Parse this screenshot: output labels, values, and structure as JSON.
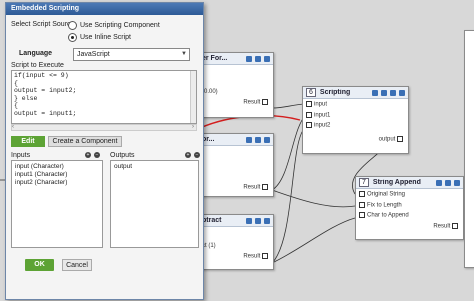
{
  "dialog": {
    "title": "Embedded Scripting",
    "source_label": "Select Script Source",
    "radio_component": "Use Scripting Component",
    "radio_inline": "Use Inline Script",
    "language_label": "Language",
    "language_value": "JavaScript",
    "script_label": "Script to Execute",
    "script_lines": [
      "if(input <= 9)",
      "{",
      "output = input2;",
      "} else",
      "{",
      "output = input1;"
    ],
    "edit_button": "Edit",
    "component_button": "Create a Component",
    "inputs_label": "Inputs",
    "inputs": [
      "input (Character)",
      "input1 (Character)",
      "input2 (Character)"
    ],
    "outputs_label": "Outputs",
    "outputs": [
      "output"
    ],
    "ok_button": "OK",
    "cancel_button": "Cancel"
  },
  "nodes": {
    "scripting": {
      "num": "6",
      "title": "Scripting",
      "inputs": [
        "input",
        "input1",
        "input2"
      ],
      "output": "output"
    },
    "string_append": {
      "num": "7",
      "title": "String Append",
      "inputs": [
        "Original String",
        "Fix to Length",
        "Char to Append"
      ],
      "output": "Result"
    },
    "partial_top": {
      "title": "er For...",
      "rows": [
        "(0.00)",
        "Result"
      ]
    },
    "partial_mid": {
      "title": "or...",
      "rows": [
        "Result"
      ]
    },
    "partial_bot": {
      "title": "btract",
      "rows": [
        "ct (1)",
        "Result"
      ]
    }
  }
}
